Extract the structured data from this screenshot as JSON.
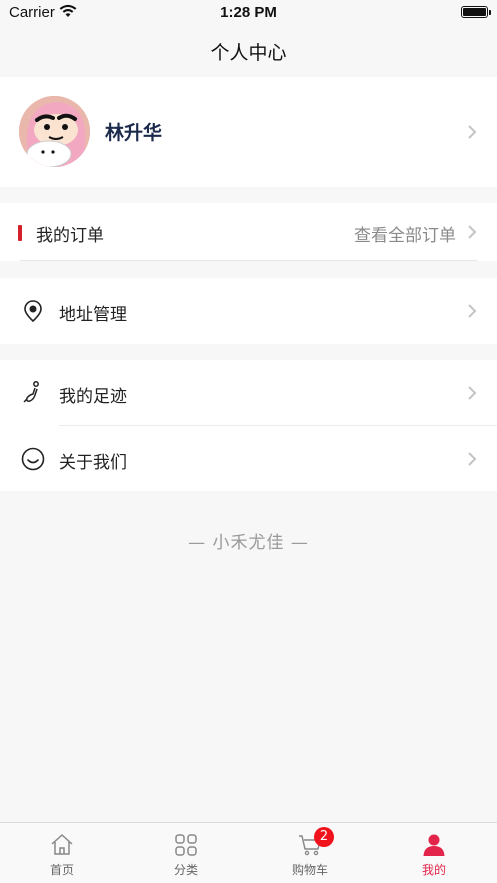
{
  "status_bar": {
    "carrier": "Carrier",
    "time": "1:28 PM"
  },
  "nav": {
    "title": "个人中心"
  },
  "profile": {
    "name": "林升华",
    "avatar_icon": "cartoon-avatar-icon"
  },
  "orders": {
    "title": "我的订单",
    "view_all": "查看全部订单",
    "accent_color": "#d4202a"
  },
  "menu": {
    "address": {
      "label": "地址管理",
      "icon": "location-pin-icon"
    },
    "footprint": {
      "label": "我的足迹",
      "icon": "footprint-icon"
    },
    "about": {
      "label": "关于我们",
      "icon": "smile-icon"
    }
  },
  "footer": {
    "text": "—   小禾尤佳   —"
  },
  "tab_bar": {
    "active_color": "#e3244b",
    "tabs": [
      {
        "label": "首页",
        "icon": "home-icon"
      },
      {
        "label": "分类",
        "icon": "grid-icon"
      },
      {
        "label": "购物车",
        "icon": "cart-icon",
        "badge": "2"
      },
      {
        "label": "我的",
        "icon": "user-icon",
        "active": true
      }
    ]
  }
}
